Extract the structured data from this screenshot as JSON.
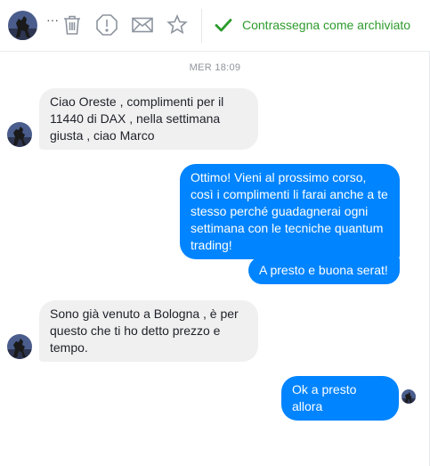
{
  "toolbar": {
    "more_label": "···",
    "archive_label": "Contrassegna come archiviato",
    "icons": [
      "trash-icon",
      "report-icon",
      "mail-icon",
      "star-icon",
      "checkmark-icon"
    ]
  },
  "conversation": {
    "timestamp": "MER 18:09",
    "messages": [
      {
        "direction": "incoming",
        "text": "Ciao Oreste , complimenti per il 11440 di DAX , nella settimana giusta , ciao Marco"
      },
      {
        "direction": "outgoing",
        "text": "Ottimo! Vieni al prossimo corso, così i complimenti li farai anche a te stesso perché guadagnerai ogni settimana con le tecniche quantum trading!"
      },
      {
        "direction": "outgoing",
        "text": "A presto e buona serat!"
      },
      {
        "direction": "incoming",
        "text": "Sono già venuto a Bologna , è per questo che ti ho detto prezzo e tempo."
      },
      {
        "direction": "outgoing",
        "text": "Ok a presto allora"
      }
    ]
  },
  "colors": {
    "outgoing_bubble": "#0084ff",
    "incoming_bubble": "#f1f0f0",
    "archive_green": "#2c9c2c"
  }
}
